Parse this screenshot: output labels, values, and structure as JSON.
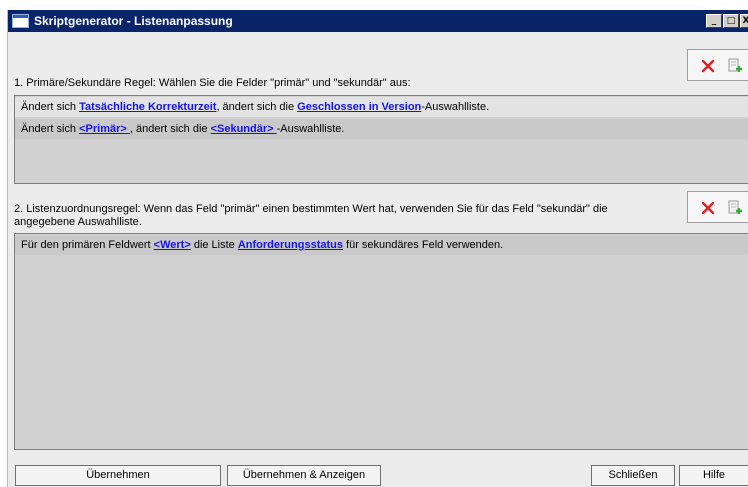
{
  "window": {
    "title": "Skriptgenerator - Listenanpassung",
    "minimize": "_",
    "maximize": "□",
    "close": "X"
  },
  "section1": {
    "label": "1. Primäre/Sekundäre Regel: Wählen Sie die Felder \"primär\" und \"sekundär\" aus:",
    "delete_icon": "delete-x-icon",
    "add_icon": "add-rule-icon",
    "rows": [
      {
        "t1": "Ändert sich ",
        "link1": "Tatsächliche Korrekturzeit",
        "t2": ", ändert sich die ",
        "link2": "Geschlossen in Version",
        "t3": "-Auswahlliste."
      },
      {
        "t1": "Ändert sich ",
        "link1": "<Primär> ",
        "t2": ", ändert sich die ",
        "link2": "<Sekundär> ",
        "t3": "-Auswahlliste."
      }
    ]
  },
  "section2": {
    "label_line1": "2. Listenzuordnungsregel:  Wenn das Feld \"primär\" einen bestimmten Wert hat, verwenden Sie für das Feld \"sekundär\" die",
    "label_line2": "angegebene Auswahlliste.",
    "delete_icon": "delete-x-icon",
    "add_icon": "add-rule-icon",
    "rows": [
      {
        "t1": "Für den primären Feldwert ",
        "link1": "<Wert>",
        "t2": " die Liste ",
        "link2": "Anforderungsstatus",
        "t3": " für sekundäres Feld verwenden."
      }
    ]
  },
  "buttons": {
    "apply": "Übernehmen",
    "apply_show": "Übernehmen & Anzeigen",
    "close": "Schließen",
    "help": "Hilfe"
  },
  "colors": {
    "titlebar": "#0a246a",
    "link": "#1414e6",
    "delete": "#e02020",
    "panel": "#d2d2d2"
  }
}
